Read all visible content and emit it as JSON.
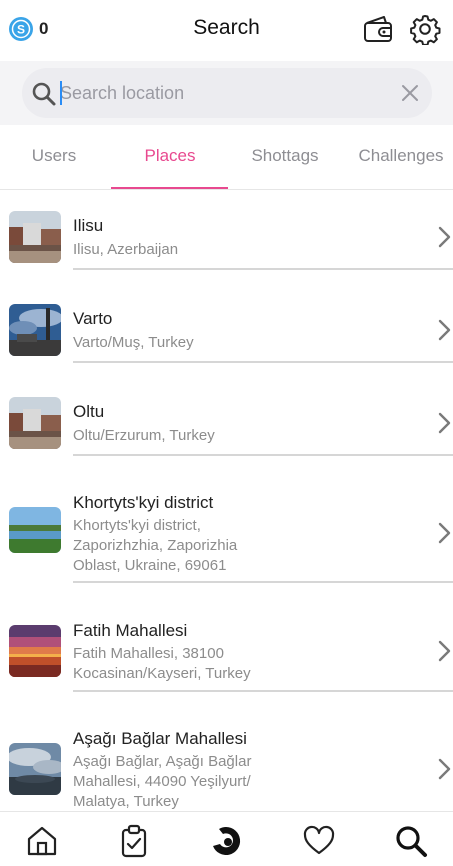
{
  "header": {
    "coin_count": "0",
    "title": "Search"
  },
  "search": {
    "placeholder": "Search location",
    "value": ""
  },
  "tabs": [
    {
      "label": "Users",
      "active": false
    },
    {
      "label": "Places",
      "active": true
    },
    {
      "label": "Shottags",
      "active": false
    },
    {
      "label": "Challenges",
      "active": false
    }
  ],
  "places": [
    {
      "title": "Ilisu",
      "subtitle": "Ilisu, Azerbaijan",
      "thumb": "town-photo"
    },
    {
      "title": "Varto",
      "subtitle": "Varto/Muş, Turkey",
      "thumb": "minaret-photo"
    },
    {
      "title": "Oltu",
      "subtitle": "Oltu/Erzurum, Turkey",
      "thumb": "town-photo"
    },
    {
      "title": "Khortyts'kyi district",
      "subtitle_lines": [
        "Khortyts'kyi district,",
        "Zaporizhzhia, Zaporizhia",
        "Oblast, Ukraine, 69061"
      ],
      "thumb": "river-photo"
    },
    {
      "title": "Fatih Mahallesi",
      "subtitle_lines": [
        "Fatih Mahallesi, 38100",
        "Kocasinan/Kayseri, Turkey"
      ],
      "thumb": "sunset-photo"
    },
    {
      "title": "Aşağı Bağlar Mahallesi",
      "subtitle_lines": [
        "Aşağı Bağlar, Aşağı Bağlar",
        "Mahallesi, 44090 Yeşilyurt/",
        "Malatya, Turkey"
      ],
      "thumb": "cloudy-sky-photo"
    }
  ],
  "tabbar": [
    "home-icon",
    "clipboard-check-icon",
    "camera-logo-icon",
    "heart-icon",
    "search-icon"
  ],
  "colors": {
    "accent": "#e8498f",
    "coin": "#3aa4e8"
  }
}
